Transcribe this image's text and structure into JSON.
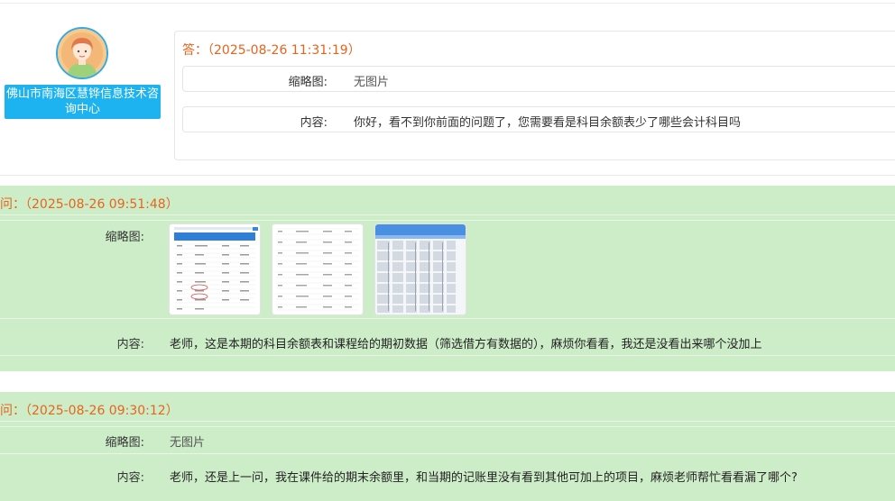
{
  "answer": {
    "org_name": "佛山市南海区慧铧信息技术咨询中心",
    "header": "答：（2025-08-26 11:31:19）",
    "thumbnail_label": "缩略图:",
    "thumbnail_value": "无图片",
    "content_label": "内容:",
    "content_value": "你好，看不到你前面的问题了，您需要看是科目余额表少了哪些会计科目吗"
  },
  "questions": [
    {
      "header": "问：（2025-08-26 09:51:48）",
      "thumbnail_label": "缩略图:",
      "thumbnail_images": [
        "screenshot-thumbnail-1",
        "screenshot-thumbnail-2",
        "screenshot-thumbnail-3"
      ],
      "content_label": "内容:",
      "content_value": "老师，这是本期的科目余额表和课程给的期初数据（筛选借方有数据的），麻烦你看看，我还是没看出来哪个没加上"
    },
    {
      "header": "问：（2025-08-26 09:30:12）",
      "thumbnail_label": "缩略图:",
      "thumbnail_value": "无图片",
      "content_label": "内容:",
      "content_value": "老师，还是上一问，我在课件给的期末余额里，和当期的记账里没有看到其他可加上的项目，麻烦老师帮忙看看漏了哪个?"
    }
  ],
  "colors": {
    "accent_orange": "#e8631c",
    "question_bg": "#cdedc8",
    "badge_blue": "#1db2f0"
  }
}
